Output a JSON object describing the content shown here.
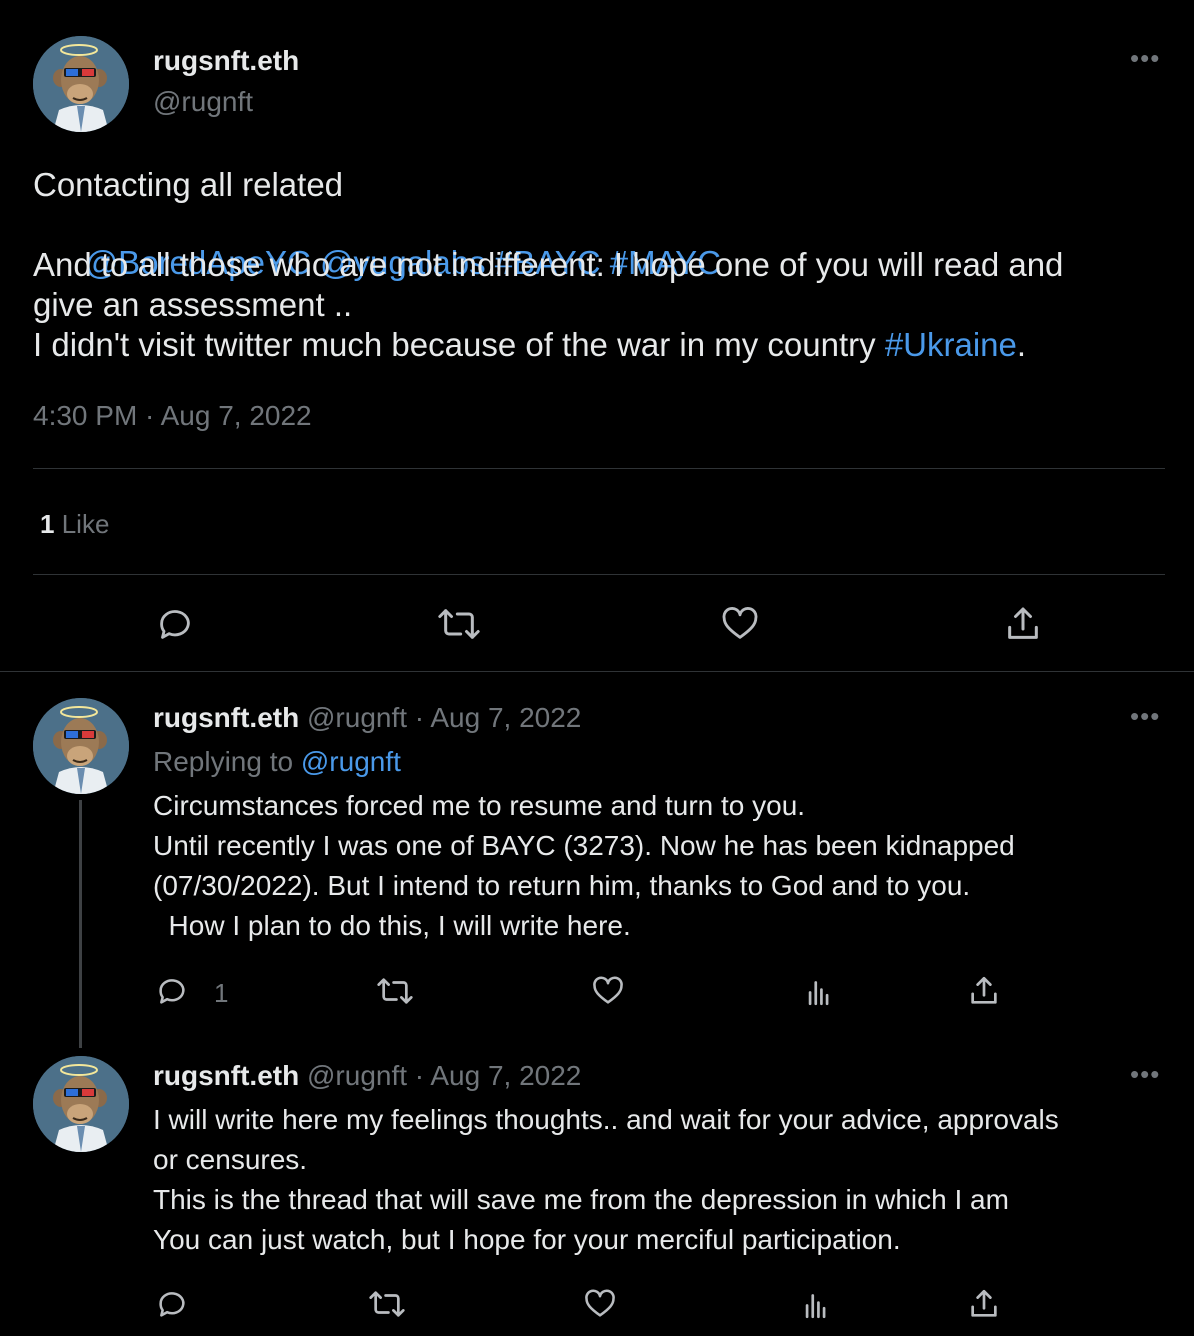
{
  "main_tweet": {
    "display_name": "rugsnft.eth",
    "handle": "@rugnft",
    "text_line1": "Contacting all related",
    "mention1": "@BoredApeYC",
    "mention2": "@yugalabs",
    "hashtag1": "#BAYC",
    "hashtag2": "#MAYC",
    "text_line3": "And to all those who are not indifferent: I hope one of you will read and",
    "text_line4": "give an assessment ..",
    "text_line5": "I didn't visit twitter much because of the war in my country ",
    "hashtag3": "#Ukraine",
    "text_line5_end": ".",
    "timestamp": "4:30 PM · Aug 7, 2022",
    "likes_count": "1",
    "likes_label": "Like"
  },
  "reply1": {
    "display_name": "rugsnft.eth",
    "handle_date": "@rugnft · Aug 7, 2022",
    "replying_prefix": "Replying to ",
    "replying_to": "@rugnft",
    "line1": "Circumstances forced me to resume and turn to you.",
    "line2": "Until recently I was one of BAYC (3273). Now he has been kidnapped",
    "line3": "(07/30/2022). But I intend to return him, thanks to God and to you.",
    "line4": "  How I plan to do this, I will write here.",
    "reply_count": "1"
  },
  "reply2": {
    "display_name": "rugsnft.eth",
    "handle_date": "@rugnft · Aug 7, 2022",
    "line1": "I will write here my feelings thoughts.. and wait for your advice, approvals",
    "line2": "or censures.",
    "line3": "This is the thread that will save me from the depression in which I am",
    "line4": "You can just watch, but I hope for your merciful participation."
  },
  "icons": [
    "reply-icon",
    "retweet-icon",
    "like-icon",
    "share-icon",
    "views-icon",
    "more-icon"
  ],
  "colors": {
    "background": "#000000",
    "text": "#e7e9ea",
    "muted": "#71767b",
    "link": "#4a99e9",
    "divider": "#2f3336"
  }
}
